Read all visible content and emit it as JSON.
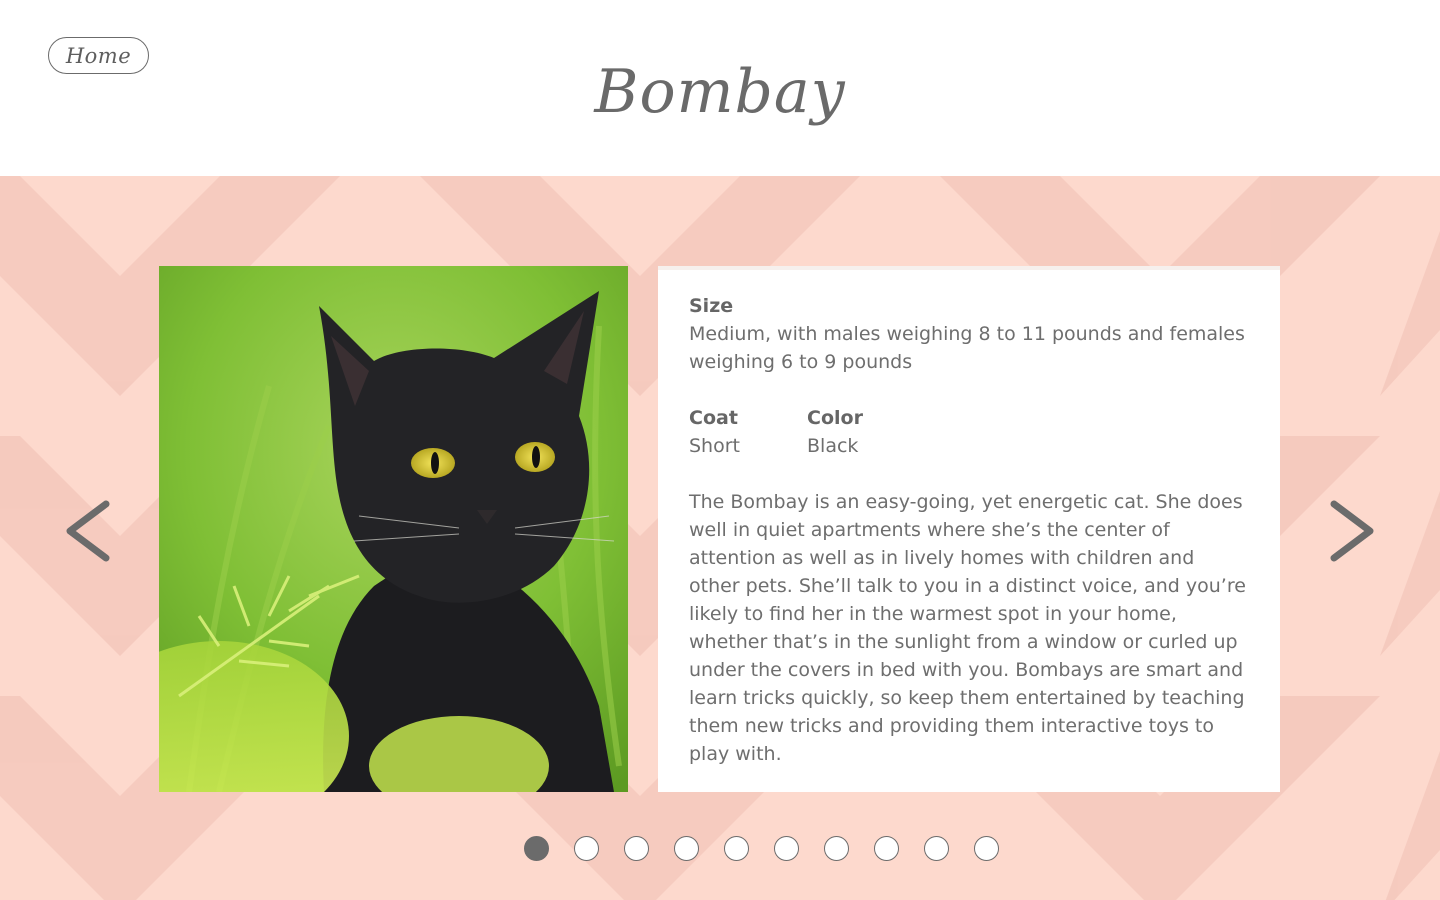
{
  "header": {
    "home_label": "Home",
    "title": "Bombay"
  },
  "photo": {
    "alt": "Black Bombay cat with yellow eyes sitting in green grass"
  },
  "details": {
    "size_label": "Size",
    "size_value": "Medium, with males weighing 8 to 11 pounds and females weighing 6 to 9 pounds",
    "coat_label": "Coat",
    "coat_value": "Short",
    "color_label": "Color",
    "color_value": "Black",
    "description": "The Bombay is an easy-going, yet energetic cat. She does well in quiet apartments where she’s the center of attention as well as in lively homes with children and other pets. She’ll talk to you in a distinct voice, and you’re likely to find her in the warmest spot in your home, whether that’s in the sunlight from a window or curled up under the covers in bed with you. Bombays are smart and learn tricks quickly, so keep them entertained by teaching them new tricks and providing them interactive toys to play with."
  },
  "navigation": {
    "prev_icon": "chevron-left-icon",
    "next_icon": "chevron-right-icon"
  },
  "pagination": {
    "total": 10,
    "current": 1
  },
  "colors": {
    "background_pink": "#fdd9cd",
    "pattern_pink": "#f4c8bc",
    "text_gray": "#6b6b6b",
    "card_white": "#ffffff"
  }
}
